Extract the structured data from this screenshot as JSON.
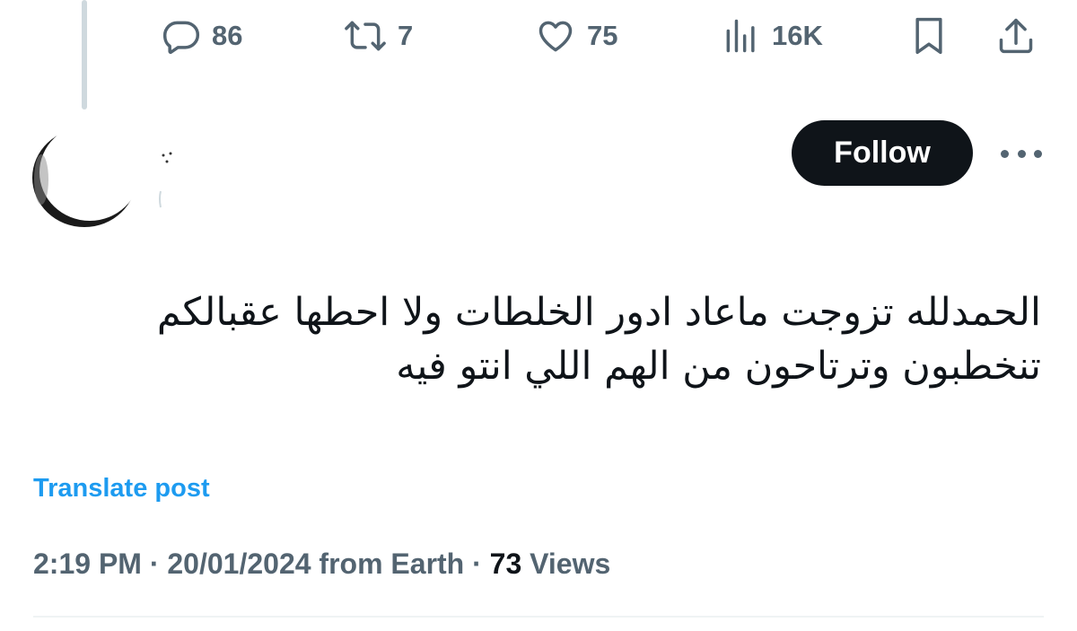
{
  "actions": {
    "replies": "86",
    "reposts": "7",
    "likes": "75",
    "views": "16K",
    "reply_icon": "comment-icon",
    "repost_icon": "repost-icon",
    "like_icon": "heart-icon",
    "views_icon": "analytics-icon",
    "bookmark_icon": "bookmark-icon",
    "share_icon": "share-icon"
  },
  "author": {
    "avatar_icon": "avatar",
    "follow_label": "Follow",
    "more_icon": "more-icon"
  },
  "post": {
    "line1": "الحمدلله تزوجت ماعاد ادور الخلطات ولا احطها عقبالكم",
    "line2": "تنخطبون وترتاحون من الهم اللي انتو فيه",
    "translate_label": "Translate post"
  },
  "meta": {
    "time": "2:19 PM",
    "separator": "·",
    "date": "20/01/2024",
    "source": "from Earth",
    "views_count": "73",
    "views_label": "Views"
  },
  "colors": {
    "accent": "#1d9bf0",
    "text": "#0f1419",
    "muted": "#536471",
    "follow_bg": "#0f1419"
  }
}
